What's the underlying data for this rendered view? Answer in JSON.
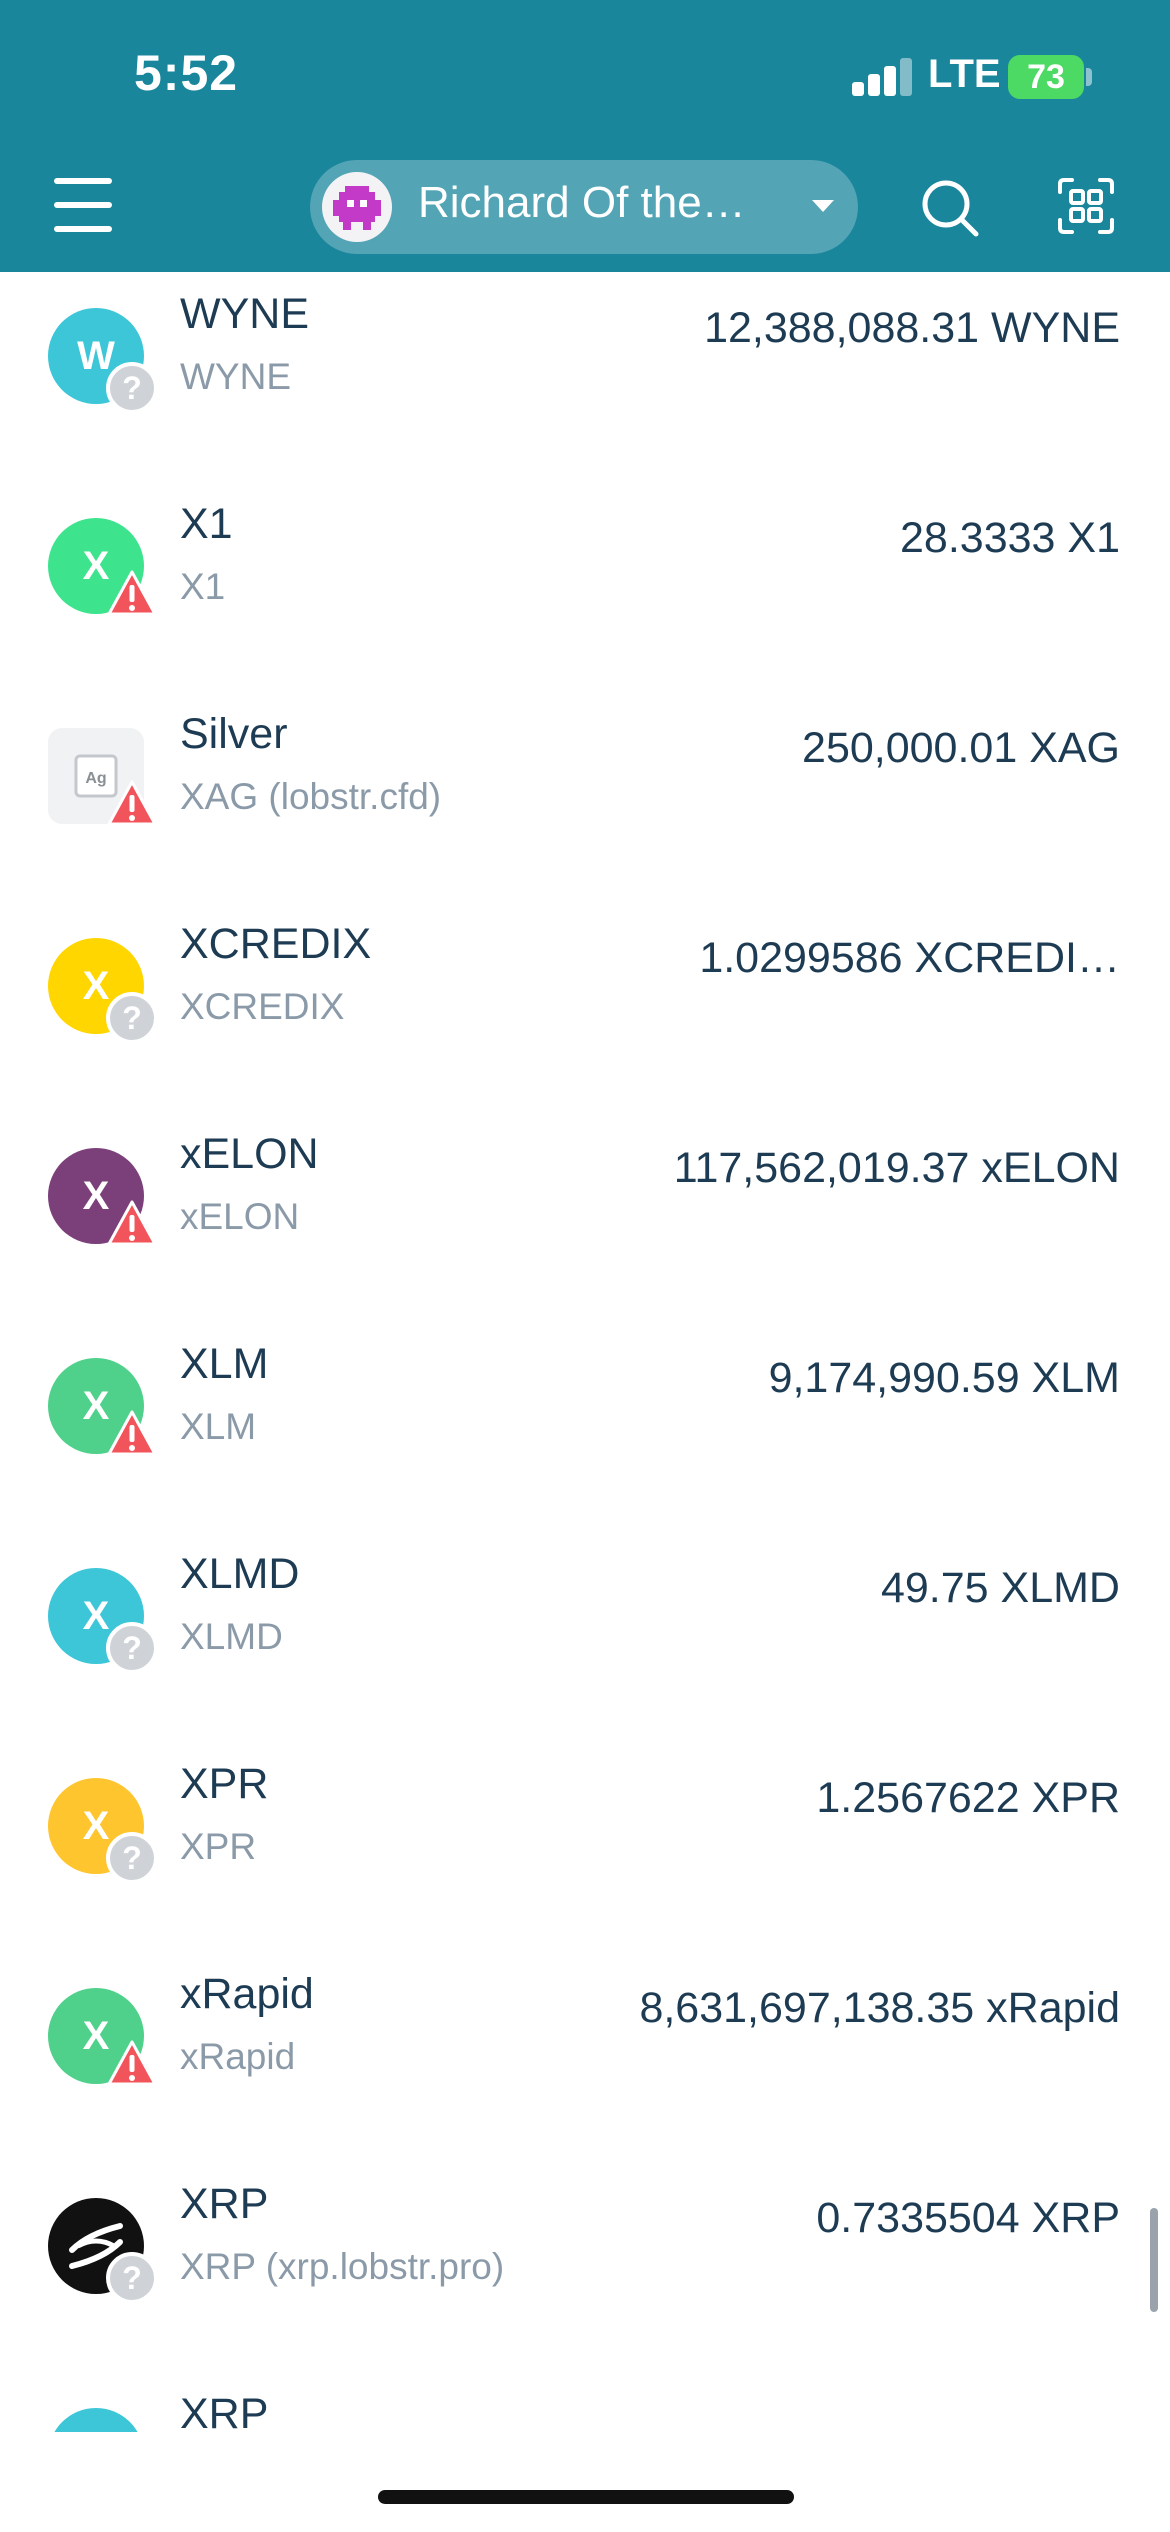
{
  "status_bar": {
    "time": "5:52",
    "network": "LTE",
    "battery": "73"
  },
  "header": {
    "account_name": "Richard Of the…",
    "colors": {
      "background": "#1a869c",
      "pill": "rgba(255,255,255,0.25)"
    },
    "icons": [
      "menu-icon",
      "avatar-icon",
      "chevron-down-icon",
      "search-icon",
      "qr-scan-icon"
    ]
  },
  "assets": [
    {
      "name": "WYNE",
      "code": "WYNE",
      "balance": "12,388,088.31 WYNE",
      "letter": "W",
      "color": "#3cc6d7",
      "badge": "unknown"
    },
    {
      "name": "X1",
      "code": "X1",
      "balance": "28.3333 X1",
      "letter": "X",
      "color": "#3ee38e",
      "badge": "warning"
    },
    {
      "name": "Silver",
      "code": "XAG (lobstr.cfd)",
      "balance": "250,000.01 XAG",
      "letter": "Ag",
      "color": "#f1f2f4",
      "badge": "warning"
    },
    {
      "name": "XCREDIX",
      "code": "XCREDIX",
      "balance": "1.0299586 XCREDI…",
      "letter": "X",
      "color": "#ffd600",
      "badge": "unknown"
    },
    {
      "name": "xELON",
      "code": "xELON",
      "balance": "117,562,019.37 xELON",
      "letter": "X",
      "color": "#7b3f7a",
      "badge": "warning"
    },
    {
      "name": "XLM",
      "code": "XLM",
      "balance": "9,174,990.59 XLM",
      "letter": "X",
      "color": "#4fd18b",
      "badge": "warning"
    },
    {
      "name": "XLMD",
      "code": "XLMD",
      "balance": "49.75 XLMD",
      "letter": "X",
      "color": "#3cc6d7",
      "badge": "unknown"
    },
    {
      "name": "XPR",
      "code": "XPR",
      "balance": "1.2567622 XPR",
      "letter": "X",
      "color": "#ffc52e",
      "badge": "unknown"
    },
    {
      "name": "xRapid",
      "code": "xRapid",
      "balance": "8,631,697,138.35 xRapid",
      "letter": "X",
      "color": "#4fd18b",
      "badge": "warning"
    },
    {
      "name": "XRP",
      "code": "XRP (xrp.lobstr.pro)",
      "balance": "0.7335504 XRP",
      "letter": "",
      "color": "#111111",
      "badge": "unknown"
    },
    {
      "name": "XRP",
      "code": "",
      "balance": "",
      "letter": "",
      "color": "#3cc6d7",
      "badge": ""
    }
  ]
}
